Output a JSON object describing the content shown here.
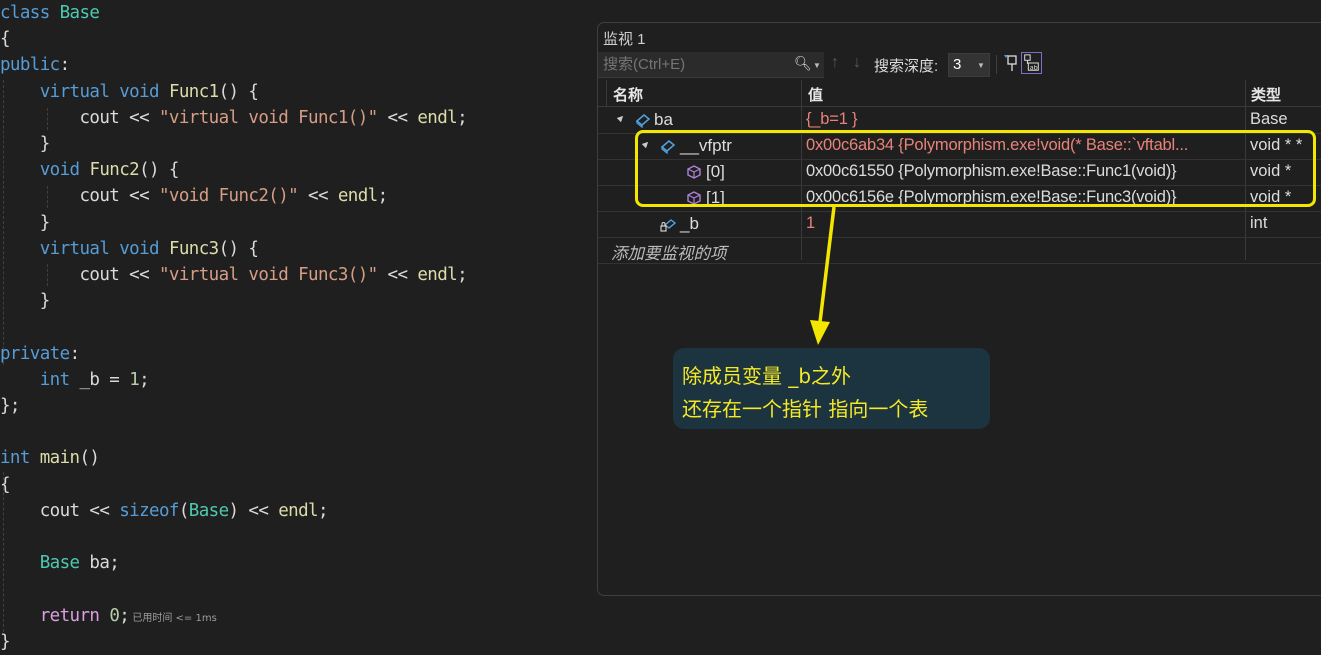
{
  "editor": {
    "lines": [
      {
        "parts": [
          [
            "kw",
            "class"
          ],
          [
            "id",
            " "
          ],
          [
            "ty",
            "Base"
          ]
        ]
      },
      {
        "parts": [
          [
            "id",
            "{"
          ]
        ]
      },
      {
        "parts": [
          [
            "kw",
            "public"
          ],
          [
            "id",
            ":"
          ]
        ]
      },
      {
        "parts": [
          [
            "id",
            "    "
          ],
          [
            "kw",
            "virtual"
          ],
          [
            "id",
            " "
          ],
          [
            "kw",
            "void"
          ],
          [
            "id",
            " "
          ],
          [
            "fn",
            "Func1"
          ],
          [
            "id",
            "() {"
          ]
        ]
      },
      {
        "parts": [
          [
            "id",
            "        cout << "
          ],
          [
            "st",
            "\"virtual void Func1()\""
          ],
          [
            "id",
            " << "
          ],
          [
            "fn",
            "endl"
          ],
          [
            "id",
            ";"
          ]
        ]
      },
      {
        "parts": [
          [
            "id",
            "    }"
          ]
        ]
      },
      {
        "parts": [
          [
            "id",
            "    "
          ],
          [
            "kw",
            "void"
          ],
          [
            "id",
            " "
          ],
          [
            "fn",
            "Func2"
          ],
          [
            "id",
            "() {"
          ]
        ]
      },
      {
        "parts": [
          [
            "id",
            "        cout << "
          ],
          [
            "st",
            "\"void Func2()\""
          ],
          [
            "id",
            " << "
          ],
          [
            "fn",
            "endl"
          ],
          [
            "id",
            ";"
          ]
        ]
      },
      {
        "parts": [
          [
            "id",
            "    }"
          ]
        ]
      },
      {
        "parts": [
          [
            "id",
            "    "
          ],
          [
            "kw",
            "virtual"
          ],
          [
            "id",
            " "
          ],
          [
            "kw",
            "void"
          ],
          [
            "id",
            " "
          ],
          [
            "fn",
            "Func3"
          ],
          [
            "id",
            "() {"
          ]
        ]
      },
      {
        "parts": [
          [
            "id",
            "        cout << "
          ],
          [
            "st",
            "\"virtual void Func3()\""
          ],
          [
            "id",
            " << "
          ],
          [
            "fn",
            "endl"
          ],
          [
            "id",
            ";"
          ]
        ]
      },
      {
        "parts": [
          [
            "id",
            "    }"
          ]
        ]
      },
      {
        "parts": []
      },
      {
        "parts": [
          [
            "kw",
            "private"
          ],
          [
            "id",
            ":"
          ]
        ]
      },
      {
        "parts": [
          [
            "id",
            "    "
          ],
          [
            "kw",
            "int"
          ],
          [
            "id",
            " _b = "
          ],
          [
            "num",
            "1"
          ],
          [
            "id",
            ";"
          ]
        ]
      },
      {
        "parts": [
          [
            "id",
            "};"
          ]
        ]
      },
      {
        "parts": []
      },
      {
        "parts": [
          [
            "kw",
            "int"
          ],
          [
            "id",
            " "
          ],
          [
            "fn",
            "main"
          ],
          [
            "id",
            "()"
          ]
        ]
      },
      {
        "parts": [
          [
            "id",
            "{"
          ]
        ]
      },
      {
        "parts": [
          [
            "id",
            "    cout << "
          ],
          [
            "kw",
            "sizeof"
          ],
          [
            "id",
            "("
          ],
          [
            "ty",
            "Base"
          ],
          [
            "id",
            ") << "
          ],
          [
            "fn",
            "endl"
          ],
          [
            "id",
            ";"
          ]
        ]
      },
      {
        "parts": []
      },
      {
        "parts": [
          [
            "id",
            "    "
          ],
          [
            "ty",
            "Base"
          ],
          [
            "id",
            " ba;"
          ]
        ]
      },
      {
        "parts": []
      },
      {
        "parts": [
          [
            "id",
            "    "
          ],
          [
            "kw2",
            "return"
          ],
          [
            "id",
            " "
          ],
          [
            "num",
            "0"
          ],
          [
            "id",
            ";"
          ],
          [
            "hint",
            " 已用时间 <= 1ms"
          ]
        ]
      },
      {
        "parts": [
          [
            "id",
            "}"
          ]
        ]
      }
    ]
  },
  "watch": {
    "title": "监视 1",
    "search_placeholder": "搜索(Ctrl+E)",
    "search_depth_label": "搜索深度:",
    "search_depth_value": "3",
    "columns": {
      "name": "名称",
      "value": "值",
      "type": "类型"
    },
    "rows": [
      {
        "name": "ba",
        "value": "{_b=1 }",
        "type": "Base",
        "icon": "class-object-icon",
        "expanded": true,
        "changed": true
      },
      {
        "name": "__vfptr",
        "value": "0x00c6ab34 {Polymorphism.exe!void(* Base::`vftabl...",
        "type": "void * *",
        "icon": "class-object-icon",
        "expanded": true,
        "changed": true
      },
      {
        "name": "[0]",
        "value": "0x00c61550 {Polymorphism.exe!Base::Func1(void)}",
        "type": "void *",
        "icon": "pointer-element-icon",
        "changed": false
      },
      {
        "name": "[1]",
        "value": "0x00c6156e {Polymorphism.exe!Base::Func3(void)}",
        "type": "void *",
        "icon": "pointer-element-icon",
        "changed": false
      },
      {
        "name": "_b",
        "value": "1",
        "type": "int",
        "icon": "private-field-icon",
        "changed": true
      }
    ],
    "add_item_label": "添加要监视的项"
  },
  "annotation": {
    "line1": "除成员变量 _b之外",
    "line2": "还存在一个指针 指向一个表",
    "color": "#f3e600"
  }
}
